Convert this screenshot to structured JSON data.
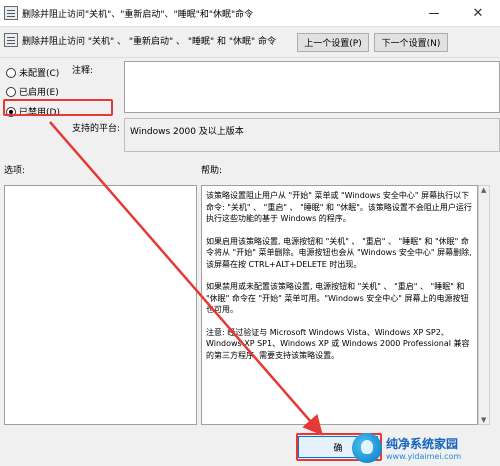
{
  "window": {
    "title": "删除并阻止访问\"关机\"、\"重新启动\"、\"睡眠\"和\"休眠\"命令",
    "minimize_label": "—",
    "close_label": "✕"
  },
  "header": {
    "policy_name": "删除并阻止访问 \"关机\" 、 \"重新启动\" 、 \"睡眠\" 和 \"休眠\" 命令",
    "prev_button": "上一个设置(P)",
    "next_button": "下一个设置(N)"
  },
  "state": {
    "options": [
      {
        "label": "未配置(C)",
        "checked": false
      },
      {
        "label": "已启用(E)",
        "checked": false
      },
      {
        "label": "已禁用(D)",
        "checked": true
      }
    ]
  },
  "comment": {
    "label": "注释:",
    "value": ""
  },
  "platform": {
    "label": "支持的平台:",
    "value": "Windows 2000 及以上版本"
  },
  "options_panel": {
    "label": "选项:"
  },
  "help": {
    "label": "帮助:",
    "paragraphs": [
      "该策略设置阻止用户从 \"开始\" 菜单或 \"Windows 安全中心\" 屏幕执行以下命令: \"关机\" 、 \"重启\" 、 \"睡眠\" 和 \"休眠\"。该策略设置不会阻止用户运行执行这些功能的基于 Windows 的程序。",
      "如果启用该策略设置, 电源按钮和 \"关机\" 、 \"重启\" 、 \"睡眠\" 和 \"休眠\" 命令将从 \"开始\" 菜单删除。电源按钮也会从 \"Windows 安全中心\" 屏幕删除, 该屏幕在按 CTRL+ALT+DELETE 时出现。",
      "如果禁用或未配置该策略设置, 电源按钮和 \"关机\" 、 \"重启\" 、 \"睡眠\" 和 \"休眠\" 命令在 \"开始\" 菜单可用。\"Windows 安全中心\" 屏幕上的电源按钮也可用。",
      "注意: 经过验证与 Microsoft Windows Vista、Windows XP SP2、Windows XP SP1、Windows XP 或 Windows 2000 Professional 兼容的第三方程序, 需要支持该策略设置。"
    ]
  },
  "footer": {
    "ok_button": "确"
  },
  "watermark": {
    "title": "纯净系统家园",
    "url": "www.yidaimei.com"
  },
  "colors": {
    "highlight": "#e53935",
    "accent": "#0078d7"
  }
}
